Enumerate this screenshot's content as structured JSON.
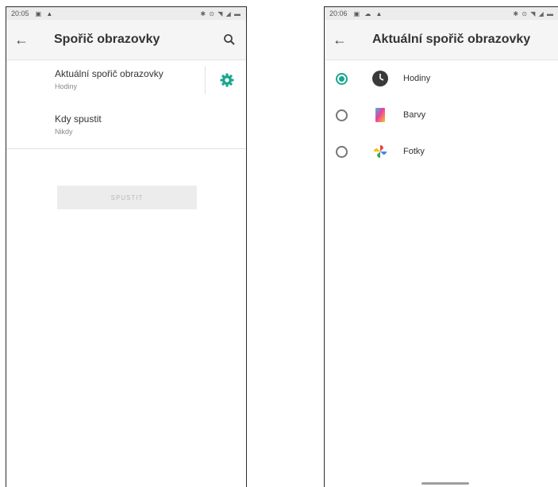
{
  "left_screen": {
    "status": {
      "time": "20:05"
    },
    "appbar": {
      "title": "Spořič obrazovky"
    },
    "prefs": [
      {
        "title": "Aktuální spořič obrazovky",
        "summary": "Hodiny"
      },
      {
        "title": "Kdy spustit",
        "summary": "Nikdy"
      }
    ],
    "start_button": "SPUSTIT"
  },
  "right_screen": {
    "status": {
      "time": "20:06"
    },
    "appbar": {
      "title": "Aktuální spořič obrazovky"
    },
    "options": [
      {
        "label": "Hodiny",
        "selected": true,
        "icon": "clock-icon"
      },
      {
        "label": "Barvy",
        "selected": false,
        "icon": "colors-icon"
      },
      {
        "label": "Fotky",
        "selected": false,
        "icon": "photos-pinwheel-icon"
      }
    ]
  },
  "colors": {
    "accent": "#1aa68e",
    "appbar_bg": "#f5f5f5",
    "disabled_button_bg": "#ececec"
  }
}
